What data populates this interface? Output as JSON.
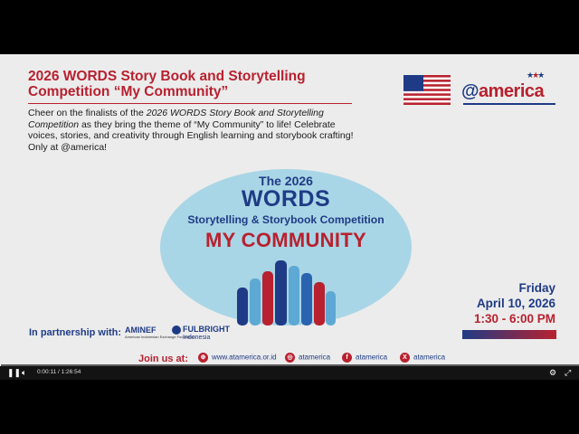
{
  "slide": {
    "title": "2026 WORDS Story Book and Storytelling Competition “My Community”",
    "desc_pre": "Cheer on the finalists of the ",
    "desc_italic": "2026 WORDS Story Book and Storytelling Competition",
    "desc_post": " as they bring the theme of “My Community” to life! Celebrate voices, stories, and creativity through English learning and storybook crafting! Only at @america!",
    "logo": "america",
    "logo_at": "@",
    "ellipse": {
      "line1": "The 2026",
      "line2": "WORDS",
      "line3": "Storytelling & Storybook Competition",
      "line4": "MY COMMUNITY"
    },
    "date": {
      "day": "Friday",
      "date": "April 10, 2026",
      "time": "1:30 - 6:00 PM"
    },
    "partner_label": "In partnership with:",
    "aminef": "AMINEF",
    "aminef_sub": "American Indonesian Exchange Foundation",
    "fulbright": "FULBRIGHT",
    "fulbright_sub": "Indonesia",
    "join_label": "Join us at:",
    "social": {
      "web": "www.atamerica.or.id",
      "instagram": "atamerica",
      "facebook": "atamerica",
      "x": "atamerica"
    }
  },
  "player": {
    "time": "0:00:11 / 1:26:54",
    "progress": 0.002,
    "play_icon": "pause-icon",
    "volume_icon": "volume-icon",
    "settings_icon": "gear-icon",
    "fullscreen_icon": "fullscreen-icon"
  },
  "colors": {
    "red": "#b8212f",
    "navy": "#1f3b86",
    "light_blue": "#a9d6e6"
  }
}
